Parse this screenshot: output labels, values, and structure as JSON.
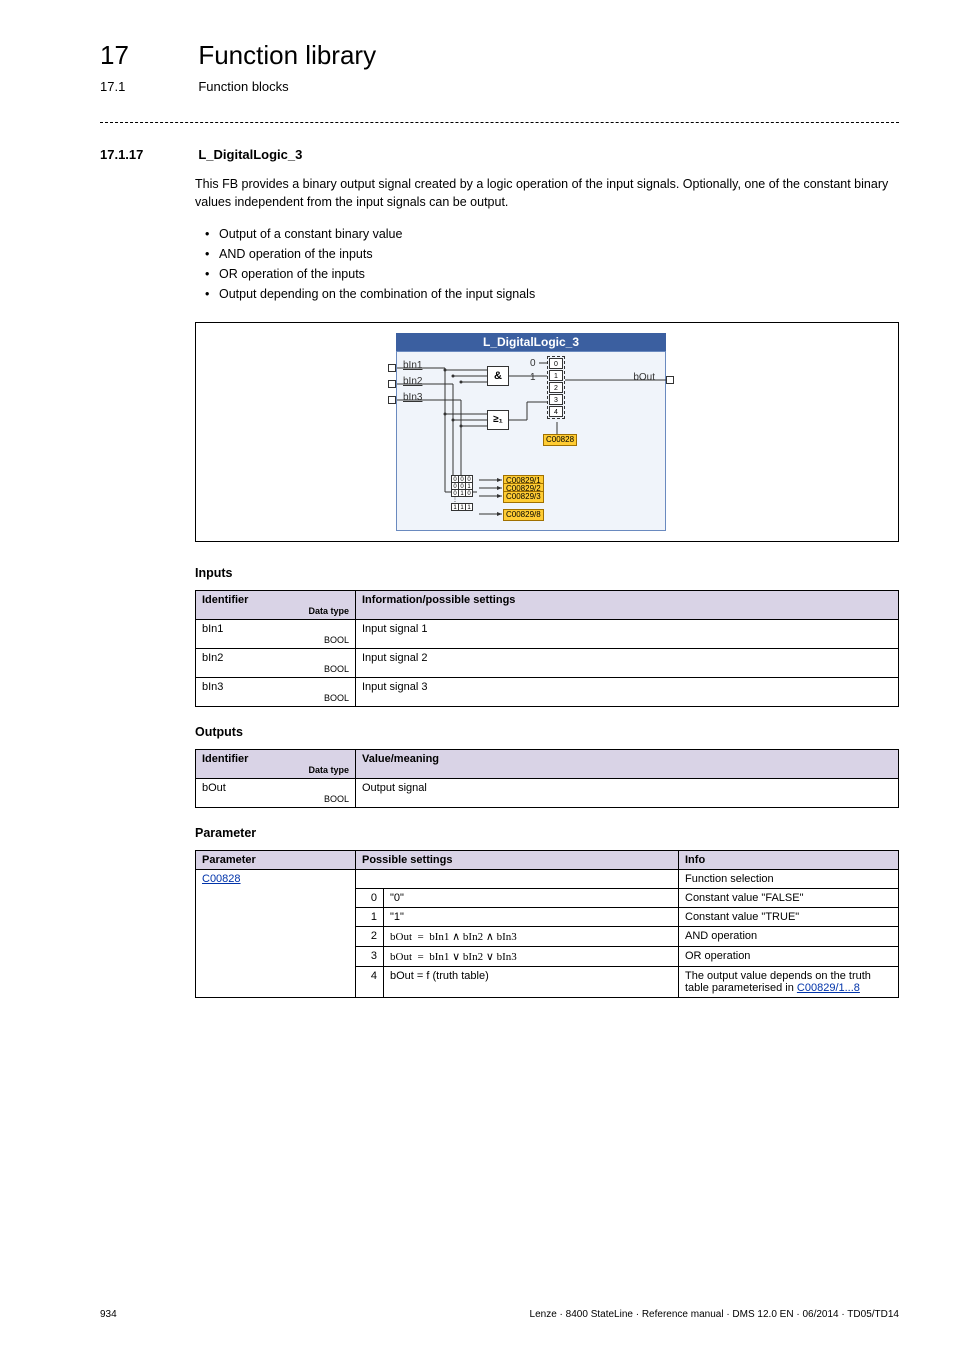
{
  "header": {
    "chapter_num": "17",
    "chapter_title": "Function library",
    "sub_num": "17.1",
    "sub_title": "Function blocks"
  },
  "section": {
    "num": "17.1.17",
    "title": "L_DigitalLogic_3"
  },
  "intro": "This FB provides a binary output signal created by a logic operation of the input signals. Optionally, one of the constant binary values independent from the input signals can be output.",
  "bullets": [
    "Output of a constant binary value",
    "AND operation of the inputs",
    "OR operation of the inputs",
    "Output depending on the combination of the input signals"
  ],
  "diagram": {
    "title": "L_DigitalLogic_3",
    "in1": "bIn1",
    "in2": "bIn2",
    "in3": "bIn3",
    "out": "bOut",
    "and": "&",
    "or": "≥₁",
    "zero": "0",
    "one": "1",
    "mux0": "0",
    "mux1": "1",
    "mux2": "2",
    "mux3": "3",
    "mux4": "4",
    "p_sel": "C00828",
    "p_tt1": "C00829/1",
    "p_tt2": "C00829/2",
    "p_tt3": "C00829/3",
    "p_tt8": "C00829/8"
  },
  "tables": {
    "inputs_heading": "Inputs",
    "inputs_th_id": "Identifier",
    "inputs_th_dt": "Data type",
    "inputs_th_info": "Information/possible settings",
    "in1_id": "bIn1",
    "in1_dt": "BOOL",
    "in1_info": "Input signal 1",
    "in2_id": "bIn2",
    "in2_dt": "BOOL",
    "in2_info": "Input signal 2",
    "in3_id": "bIn3",
    "in3_dt": "BOOL",
    "in3_info": "Input signal 3",
    "outputs_heading": "Outputs",
    "outputs_th_id": "Identifier",
    "outputs_th_dt": "Data type",
    "outputs_th_info": "Value/meaning",
    "out_id": "bOut",
    "out_dt": "BOOL",
    "out_info": "Output signal",
    "param_heading": "Parameter",
    "param_th_p": "Parameter",
    "param_th_ps": "Possible settings",
    "param_th_info": "Info",
    "param_link": "C00828",
    "param_info": "Function selection",
    "r0_n": "0",
    "r0_ps": "\"0\"",
    "r0_info": "Constant value \"FALSE\"",
    "r1_n": "1",
    "r1_ps": "\"1\"",
    "r1_info": "Constant value \"TRUE\"",
    "r2_n": "2",
    "r2_ps_a": "bOut",
    "r2_ps_b": "bIn1 ∧ bIn2 ∧ bIn3",
    "r2_info": "AND operation",
    "r3_n": "3",
    "r3_ps_a": "bOut",
    "r3_ps_b": "bIn1 ∨ bIn2 ∨ bIn3",
    "r3_info": "OR operation",
    "r4_n": "4",
    "r4_ps": "bOut = f (truth table)",
    "r4_info_a": "The output value depends on the truth table parameterised in ",
    "r4_info_link": "C00829/1...8"
  },
  "footer": {
    "page": "934",
    "doc": "Lenze · 8400 StateLine · Reference manual · DMS 12.0 EN · 06/2014 · TD05/TD14"
  }
}
